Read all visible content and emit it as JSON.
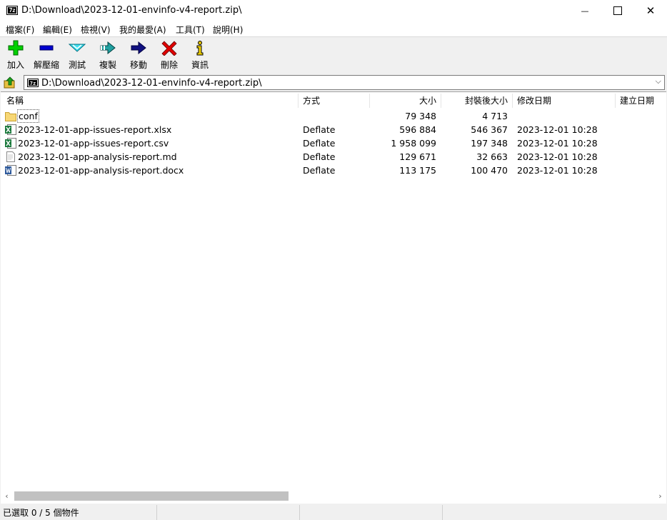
{
  "window": {
    "title": "D:\\Download\\2023-12-01-envinfo-v4-report.zip\\",
    "app_icon_text": "7z",
    "minimize_symbol": "—",
    "close_symbol": "✕"
  },
  "menu": [
    "檔案(F)",
    "編輯(E)",
    "檢視(V)",
    "我的最愛(A)",
    "工具(T)",
    "說明(H)"
  ],
  "toolbar": [
    {
      "label": "加入",
      "icon": "add-icon",
      "color": "#00c800"
    },
    {
      "label": "解壓縮",
      "icon": "extract-icon",
      "color": "#0000c8"
    },
    {
      "label": "測試",
      "icon": "test-icon",
      "color": "#00b4c8"
    },
    {
      "label": "複製",
      "icon": "copy-icon",
      "color": "#008080"
    },
    {
      "label": "移動",
      "icon": "move-icon",
      "color": "#000080"
    },
    {
      "label": "刪除",
      "icon": "delete-icon",
      "color": "#e00000"
    },
    {
      "label": "資訊",
      "icon": "info-icon",
      "color": "#c8a000"
    }
  ],
  "address": {
    "path": "D:\\Download\\2023-12-01-envinfo-v4-report.zip\\",
    "dropdown_symbol": "⌵"
  },
  "columns": [
    "名稱",
    "方式",
    "大小",
    "封裝後大小",
    "修改日期",
    "建立日期"
  ],
  "files": [
    {
      "name": "conf",
      "method": "",
      "size": "79 348",
      "packed": "4 713",
      "modified": "",
      "icon": "folder-icon"
    },
    {
      "name": "2023-12-01-app-issues-report.xlsx",
      "method": "Deflate",
      "size": "596 884",
      "packed": "546 367",
      "modified": "2023-12-01 10:28",
      "icon": "excel-icon"
    },
    {
      "name": "2023-12-01-app-issues-report.csv",
      "method": "Deflate",
      "size": "1 958 099",
      "packed": "197 348",
      "modified": "2023-12-01 10:28",
      "icon": "excel-icon"
    },
    {
      "name": "2023-12-01-app-analysis-report.md",
      "method": "Deflate",
      "size": "129 671",
      "packed": "32 663",
      "modified": "2023-12-01 10:28",
      "icon": "text-file-icon"
    },
    {
      "name": "2023-12-01-app-analysis-report.docx",
      "method": "Deflate",
      "size": "113 175",
      "packed": "100 470",
      "modified": "2023-12-01 10:28",
      "icon": "word-icon"
    }
  ],
  "scrollbar": {
    "left_arrow": "‹",
    "right_arrow": "›"
  },
  "status": {
    "text": "已選取 0 / 5 個物件"
  }
}
